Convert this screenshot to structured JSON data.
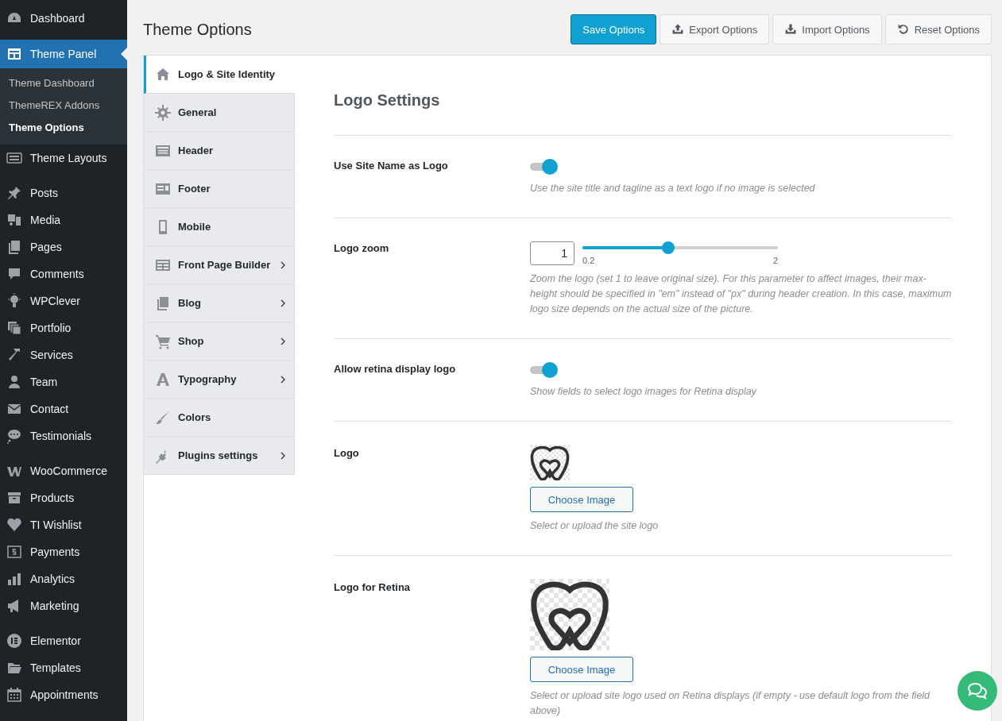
{
  "sidebar": {
    "groups": [
      [
        {
          "label": "Dashboard",
          "selected": false
        }
      ],
      [
        {
          "label": "Theme Panel",
          "selected": true,
          "children": [
            {
              "label": "Theme Dashboard",
              "selected": false
            },
            {
              "label": "ThemeREX Addons",
              "selected": false
            },
            {
              "label": "Theme Options",
              "selected": true
            }
          ]
        },
        {
          "label": "Theme Layouts",
          "selected": false
        }
      ],
      [
        {
          "label": "Posts",
          "selected": false
        },
        {
          "label": "Media",
          "selected": false
        },
        {
          "label": "Pages",
          "selected": false
        },
        {
          "label": "Comments",
          "selected": false
        },
        {
          "label": "WPClever",
          "selected": false
        },
        {
          "label": "Portfolio",
          "selected": false
        },
        {
          "label": "Services",
          "selected": false
        },
        {
          "label": "Team",
          "selected": false
        },
        {
          "label": "Contact",
          "selected": false
        },
        {
          "label": "Testimonials",
          "selected": false
        }
      ],
      [
        {
          "label": "WooCommerce",
          "selected": false
        },
        {
          "label": "Products",
          "selected": false
        },
        {
          "label": "TI Wishlist",
          "selected": false
        },
        {
          "label": "Payments",
          "selected": false
        },
        {
          "label": "Analytics",
          "selected": false
        },
        {
          "label": "Marketing",
          "selected": false
        }
      ],
      [
        {
          "label": "Elementor",
          "selected": false
        },
        {
          "label": "Templates",
          "selected": false
        },
        {
          "label": "Appointments",
          "selected": false
        }
      ]
    ]
  },
  "page": {
    "title": "Theme Options",
    "buttons": [
      {
        "label": "Save Options",
        "kind": "primary"
      },
      {
        "label": "Export Options",
        "kind": "export"
      },
      {
        "label": "Import Options",
        "kind": "import"
      },
      {
        "label": "Reset Options",
        "kind": "reset"
      }
    ]
  },
  "tabs": [
    {
      "label": "Logo & Site Identity",
      "selected": true,
      "submenu": false
    },
    {
      "label": "General",
      "selected": false,
      "submenu": false
    },
    {
      "label": "Header",
      "selected": false,
      "submenu": false
    },
    {
      "label": "Footer",
      "selected": false,
      "submenu": false
    },
    {
      "label": "Mobile",
      "selected": false,
      "submenu": false
    },
    {
      "label": "Front Page Builder",
      "selected": false,
      "submenu": true
    },
    {
      "label": "Blog",
      "selected": false,
      "submenu": true
    },
    {
      "label": "Shop",
      "selected": false,
      "submenu": true
    },
    {
      "label": "Typography",
      "selected": false,
      "submenu": true
    },
    {
      "label": "Colors",
      "selected": false,
      "submenu": false
    },
    {
      "label": "Plugins settings",
      "selected": false,
      "submenu": true
    }
  ],
  "section": {
    "title": "Logo Settings",
    "settings": [
      {
        "kind": "toggle",
        "label": "Use Site Name as Logo",
        "on": true,
        "description": "Use the site title and tagline as a text logo if no image is selected"
      },
      {
        "kind": "slider",
        "label": "Logo zoom",
        "value": "1",
        "level": 0.44,
        "min_label": "0.2",
        "max_label": "2",
        "description": "Zoom the logo (set 1 to leave original size). For this parameter to affect images, their max-height should be specified in \"em\" instead of \"px\" during header creation. In this case, maximum logo size depends on the actual size of the picture."
      },
      {
        "kind": "toggle",
        "label": "Allow retina display logo",
        "on": true,
        "description": "Show fields to select logo images for Retina display"
      },
      {
        "kind": "image",
        "label": "Logo",
        "button": "Choose Image",
        "description": "Select or upload the site logo"
      },
      {
        "kind": "retina_image",
        "label": "Logo for Retina",
        "button": "Choose Image",
        "description": "Select or upload site logo used on Retina displays (if empty - use default logo from the field above)"
      }
    ]
  }
}
